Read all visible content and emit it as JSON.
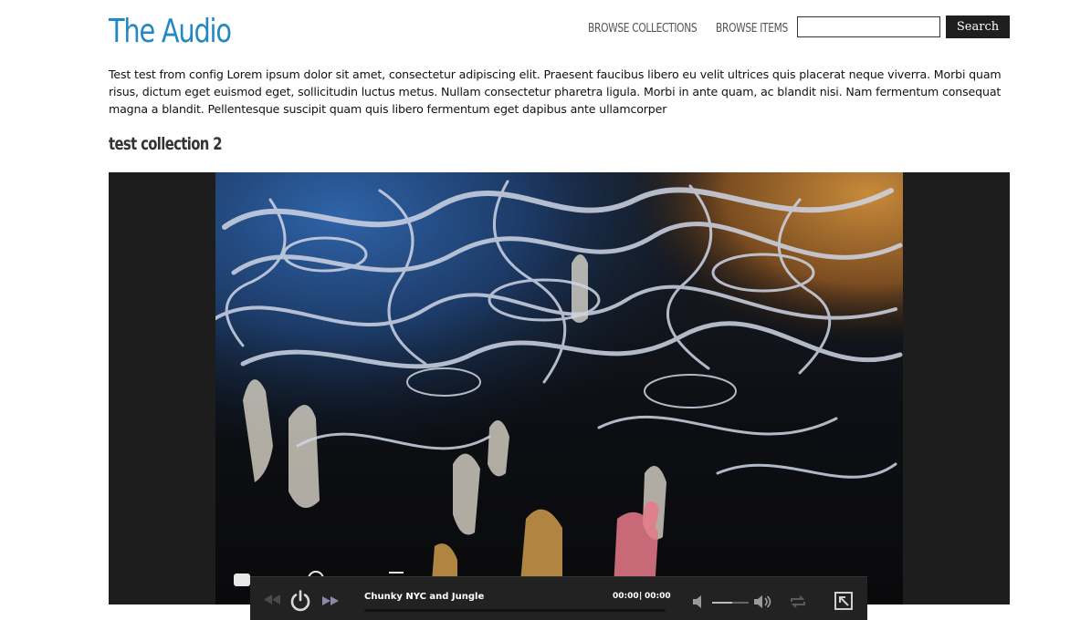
{
  "header": {
    "site_title": "The Audio",
    "nav": [
      {
        "label": "BROWSE COLLECTIONS"
      },
      {
        "label": "BROWSE ITEMS"
      }
    ],
    "search": {
      "value": "",
      "placeholder": "",
      "button_label": "Search"
    }
  },
  "main": {
    "description": "Test test from config Lorem ipsum dolor sit amet, consectetur adipiscing elit. Praesent faucibus libero eu velit ultrices quis placerat neque viverra. Morbi quam risus, dictum eget euismod eget, sollicitudin luctus metus. Nullam consectetur pharetra ligula. Morbi in ante quam, ac blandit nisi. Nam fermentum consequat magna a blandit. Pellentesque suscipit quam quis libero fermentum eget dapibus ante ullamcorper",
    "collection_title": "test collection 2"
  },
  "player": {
    "track_title": "Chunky NYC and Jungle",
    "current_time": "00:00",
    "separator": "|",
    "total_time": "00:00",
    "progress": 0.0,
    "volume": 0.55,
    "icons": {
      "previous": "skip-back-icon",
      "power": "power-icon",
      "next": "skip-forward-icon",
      "volume_down": "volume-low-icon",
      "volume_up": "volume-high-icon",
      "repeat": "repeat-icon",
      "popout": "popout-icon"
    }
  },
  "colors": {
    "title_blue": "#2389c5",
    "stage_bg": "#1d1d1d",
    "player_bg": "#222222",
    "button_bg": "#1f1f1f"
  }
}
